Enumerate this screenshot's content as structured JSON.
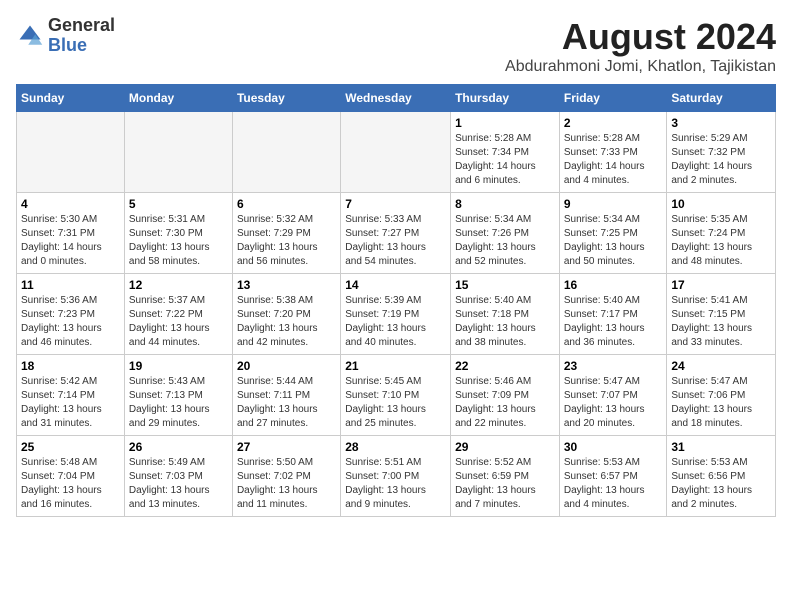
{
  "logo": {
    "general": "General",
    "blue": "Blue"
  },
  "title": "August 2024",
  "location": "Abdurahmoni Jomi, Khatlon, Tajikistan",
  "headers": [
    "Sunday",
    "Monday",
    "Tuesday",
    "Wednesday",
    "Thursday",
    "Friday",
    "Saturday"
  ],
  "weeks": [
    [
      {
        "day": "",
        "info": ""
      },
      {
        "day": "",
        "info": ""
      },
      {
        "day": "",
        "info": ""
      },
      {
        "day": "",
        "info": ""
      },
      {
        "day": "1",
        "info": "Sunrise: 5:28 AM\nSunset: 7:34 PM\nDaylight: 14 hours\nand 6 minutes."
      },
      {
        "day": "2",
        "info": "Sunrise: 5:28 AM\nSunset: 7:33 PM\nDaylight: 14 hours\nand 4 minutes."
      },
      {
        "day": "3",
        "info": "Sunrise: 5:29 AM\nSunset: 7:32 PM\nDaylight: 14 hours\nand 2 minutes."
      }
    ],
    [
      {
        "day": "4",
        "info": "Sunrise: 5:30 AM\nSunset: 7:31 PM\nDaylight: 14 hours\nand 0 minutes."
      },
      {
        "day": "5",
        "info": "Sunrise: 5:31 AM\nSunset: 7:30 PM\nDaylight: 13 hours\nand 58 minutes."
      },
      {
        "day": "6",
        "info": "Sunrise: 5:32 AM\nSunset: 7:29 PM\nDaylight: 13 hours\nand 56 minutes."
      },
      {
        "day": "7",
        "info": "Sunrise: 5:33 AM\nSunset: 7:27 PM\nDaylight: 13 hours\nand 54 minutes."
      },
      {
        "day": "8",
        "info": "Sunrise: 5:34 AM\nSunset: 7:26 PM\nDaylight: 13 hours\nand 52 minutes."
      },
      {
        "day": "9",
        "info": "Sunrise: 5:34 AM\nSunset: 7:25 PM\nDaylight: 13 hours\nand 50 minutes."
      },
      {
        "day": "10",
        "info": "Sunrise: 5:35 AM\nSunset: 7:24 PM\nDaylight: 13 hours\nand 48 minutes."
      }
    ],
    [
      {
        "day": "11",
        "info": "Sunrise: 5:36 AM\nSunset: 7:23 PM\nDaylight: 13 hours\nand 46 minutes."
      },
      {
        "day": "12",
        "info": "Sunrise: 5:37 AM\nSunset: 7:22 PM\nDaylight: 13 hours\nand 44 minutes."
      },
      {
        "day": "13",
        "info": "Sunrise: 5:38 AM\nSunset: 7:20 PM\nDaylight: 13 hours\nand 42 minutes."
      },
      {
        "day": "14",
        "info": "Sunrise: 5:39 AM\nSunset: 7:19 PM\nDaylight: 13 hours\nand 40 minutes."
      },
      {
        "day": "15",
        "info": "Sunrise: 5:40 AM\nSunset: 7:18 PM\nDaylight: 13 hours\nand 38 minutes."
      },
      {
        "day": "16",
        "info": "Sunrise: 5:40 AM\nSunset: 7:17 PM\nDaylight: 13 hours\nand 36 minutes."
      },
      {
        "day": "17",
        "info": "Sunrise: 5:41 AM\nSunset: 7:15 PM\nDaylight: 13 hours\nand 33 minutes."
      }
    ],
    [
      {
        "day": "18",
        "info": "Sunrise: 5:42 AM\nSunset: 7:14 PM\nDaylight: 13 hours\nand 31 minutes."
      },
      {
        "day": "19",
        "info": "Sunrise: 5:43 AM\nSunset: 7:13 PM\nDaylight: 13 hours\nand 29 minutes."
      },
      {
        "day": "20",
        "info": "Sunrise: 5:44 AM\nSunset: 7:11 PM\nDaylight: 13 hours\nand 27 minutes."
      },
      {
        "day": "21",
        "info": "Sunrise: 5:45 AM\nSunset: 7:10 PM\nDaylight: 13 hours\nand 25 minutes."
      },
      {
        "day": "22",
        "info": "Sunrise: 5:46 AM\nSunset: 7:09 PM\nDaylight: 13 hours\nand 22 minutes."
      },
      {
        "day": "23",
        "info": "Sunrise: 5:47 AM\nSunset: 7:07 PM\nDaylight: 13 hours\nand 20 minutes."
      },
      {
        "day": "24",
        "info": "Sunrise: 5:47 AM\nSunset: 7:06 PM\nDaylight: 13 hours\nand 18 minutes."
      }
    ],
    [
      {
        "day": "25",
        "info": "Sunrise: 5:48 AM\nSunset: 7:04 PM\nDaylight: 13 hours\nand 16 minutes."
      },
      {
        "day": "26",
        "info": "Sunrise: 5:49 AM\nSunset: 7:03 PM\nDaylight: 13 hours\nand 13 minutes."
      },
      {
        "day": "27",
        "info": "Sunrise: 5:50 AM\nSunset: 7:02 PM\nDaylight: 13 hours\nand 11 minutes."
      },
      {
        "day": "28",
        "info": "Sunrise: 5:51 AM\nSunset: 7:00 PM\nDaylight: 13 hours\nand 9 minutes."
      },
      {
        "day": "29",
        "info": "Sunrise: 5:52 AM\nSunset: 6:59 PM\nDaylight: 13 hours\nand 7 minutes."
      },
      {
        "day": "30",
        "info": "Sunrise: 5:53 AM\nSunset: 6:57 PM\nDaylight: 13 hours\nand 4 minutes."
      },
      {
        "day": "31",
        "info": "Sunrise: 5:53 AM\nSunset: 6:56 PM\nDaylight: 13 hours\nand 2 minutes."
      }
    ]
  ]
}
